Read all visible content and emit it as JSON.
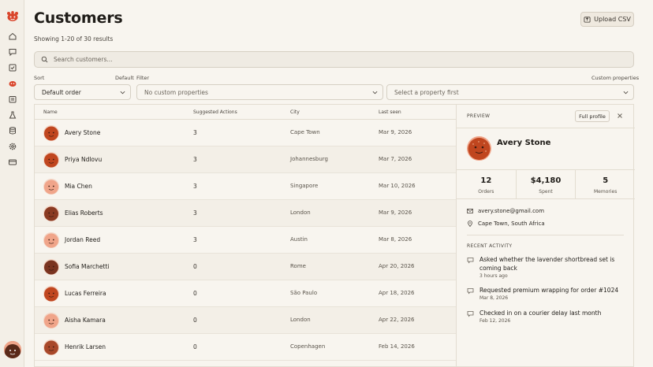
{
  "page": {
    "title": "Customers",
    "results_text": "Showing 1-20 of 30 results",
    "upload_label": "Upload CSV"
  },
  "search": {
    "placeholder": "Search customers..."
  },
  "filters": {
    "sort_label": "Sort",
    "sort_default_hint": "Default",
    "sort_value": "Default order",
    "filter_label": "Filter",
    "custom_properties_hint": "Custom properties",
    "property_value": "No custom properties",
    "value_placeholder": "Select a property first"
  },
  "table": {
    "columns": [
      "Name",
      "Suggested Actions",
      "City",
      "Last seen"
    ],
    "rows": [
      {
        "name": "Avery Stone",
        "actions": "3",
        "city": "Cape Town",
        "last_seen": "Mar 9, 2026",
        "avatar_color": "#c0461f"
      },
      {
        "name": "Priya Ndlovu",
        "actions": "3",
        "city": "Johannesburg",
        "last_seen": "Mar 7, 2026",
        "avatar_color": "#c0461f"
      },
      {
        "name": "Mia Chen",
        "actions": "3",
        "city": "Singapore",
        "last_seen": "Mar 10, 2026",
        "avatar_color": "#f0a58a"
      },
      {
        "name": "Elias Roberts",
        "actions": "3",
        "city": "London",
        "last_seen": "Mar 9, 2026",
        "avatar_color": "#8a3a22"
      },
      {
        "name": "Jordan Reed",
        "actions": "3",
        "city": "Austin",
        "last_seen": "Mar 8, 2026",
        "avatar_color": "#f0a58a"
      },
      {
        "name": "Sofia Marchetti",
        "actions": "0",
        "city": "Rome",
        "last_seen": "Apr 20, 2026",
        "avatar_color": "#7a3420"
      },
      {
        "name": "Lucas Ferreira",
        "actions": "0",
        "city": "São Paulo",
        "last_seen": "Apr 18, 2026",
        "avatar_color": "#c0461f"
      },
      {
        "name": "Aisha Kamara",
        "actions": "0",
        "city": "London",
        "last_seen": "Apr 22, 2026",
        "avatar_color": "#f0a58a"
      },
      {
        "name": "Henrik Larsen",
        "actions": "0",
        "city": "Copenhagen",
        "last_seen": "Feb 14, 2026",
        "avatar_color": "#a8482a"
      }
    ]
  },
  "preview": {
    "label": "PREVIEW",
    "full_profile_label": "Full profile",
    "name": "Avery Stone",
    "stats": [
      {
        "value": "12",
        "label": "Orders"
      },
      {
        "value": "$4,180",
        "label": "Spent"
      },
      {
        "value": "5",
        "label": "Memories"
      }
    ],
    "email": "avery.stone@gmail.com",
    "location": "Cape Town, South Africa",
    "recent_activity_label": "RECENT ACTIVITY",
    "activities": [
      {
        "text": "Asked whether the lavender shortbread set is coming back",
        "date": "3 hours ago"
      },
      {
        "text": "Requested premium wrapping for order #1024",
        "date": "Mar 8, 2026"
      },
      {
        "text": "Checked in on a courier delay last month",
        "date": "Feb 12, 2026"
      }
    ]
  },
  "colors": {
    "brand": "#d9452b",
    "background": "#f8f5ef",
    "sidebar": "#f3efe7",
    "border": "#e3ddd1"
  },
  "icons": [
    "logo-icon",
    "home-icon",
    "chat-icon",
    "checklist-icon",
    "bot-icon",
    "inbox-icon",
    "flask-icon",
    "database-icon",
    "settings-icon",
    "card-icon",
    "upload-icon",
    "search-icon",
    "chevron-down-icon",
    "close-icon",
    "mail-icon",
    "location-pin-icon",
    "message-icon"
  ]
}
